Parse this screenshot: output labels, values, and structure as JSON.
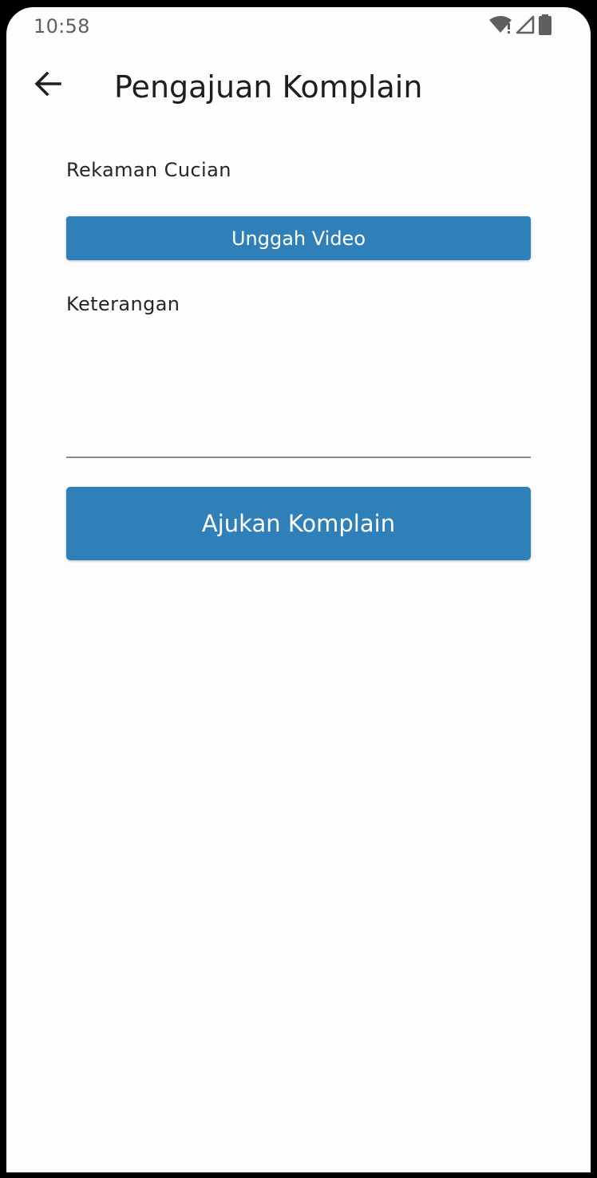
{
  "status_bar": {
    "time": "10:58",
    "icons": [
      "wifi-icon",
      "signal-icon",
      "battery-icon"
    ]
  },
  "app_bar": {
    "back_icon": "arrow-back-icon",
    "title": "Pengajuan Komplain"
  },
  "form": {
    "video_label": "Rekaman Cucian",
    "upload_button_label": "Unggah Video",
    "description_label": "Keterangan",
    "description_value": "",
    "submit_button_label": "Ajukan Komplain"
  },
  "colors": {
    "primary": "#2f80b9",
    "background": "#fdfdfd",
    "text": "#262626"
  }
}
